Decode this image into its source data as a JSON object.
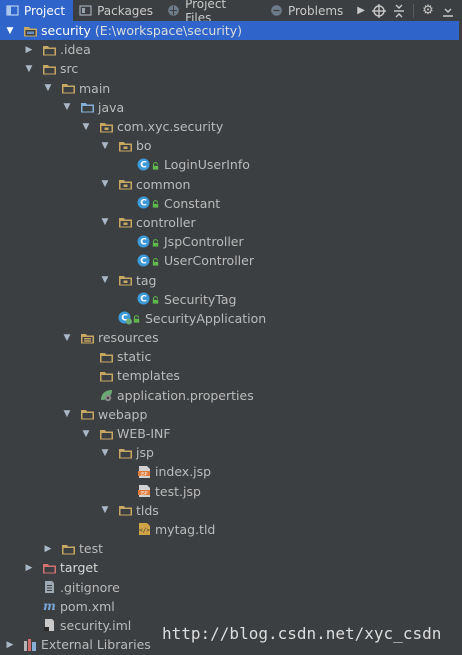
{
  "tabs": [
    {
      "label": "Project",
      "active": true,
      "icon": "project-icon"
    },
    {
      "label": "Packages",
      "active": false,
      "icon": "packages-icon"
    },
    {
      "label": "Project Files",
      "active": false,
      "icon": "project-files-icon"
    },
    {
      "label": "Problems",
      "active": false,
      "icon": "problems-icon"
    }
  ],
  "toolbar": [
    "more-tabs-icon",
    "sync-icon",
    "collapse-icon",
    "gear-icon",
    "hide-icon"
  ],
  "tree": [
    {
      "label": "security",
      "suffix": "(E:\\workspace\\security)",
      "depth": 0,
      "arrow": "open",
      "icon": "module-folder",
      "selected": true
    },
    {
      "label": ".idea",
      "depth": 1,
      "arrow": "closed",
      "icon": "folder"
    },
    {
      "label": "src",
      "depth": 1,
      "arrow": "open",
      "icon": "folder"
    },
    {
      "label": "main",
      "depth": 2,
      "arrow": "open",
      "icon": "folder"
    },
    {
      "label": "java",
      "depth": 3,
      "arrow": "open",
      "icon": "source-folder"
    },
    {
      "label": "com.xyc.security",
      "depth": 4,
      "arrow": "open",
      "icon": "package"
    },
    {
      "label": "bo",
      "depth": 5,
      "arrow": "open",
      "icon": "package"
    },
    {
      "label": "LoginUserInfo",
      "depth": 6,
      "arrow": "none",
      "icon": "class"
    },
    {
      "label": "common",
      "depth": 5,
      "arrow": "open",
      "icon": "package"
    },
    {
      "label": "Constant",
      "depth": 6,
      "arrow": "none",
      "icon": "class"
    },
    {
      "label": "controller",
      "depth": 5,
      "arrow": "open",
      "icon": "package"
    },
    {
      "label": "JspController",
      "depth": 6,
      "arrow": "none",
      "icon": "class"
    },
    {
      "label": "UserController",
      "depth": 6,
      "arrow": "none",
      "icon": "class"
    },
    {
      "label": "tag",
      "depth": 5,
      "arrow": "open",
      "icon": "package"
    },
    {
      "label": "SecurityTag",
      "depth": 6,
      "arrow": "none",
      "icon": "class"
    },
    {
      "label": "SecurityApplication",
      "depth": 5,
      "arrow": "none",
      "icon": "spring-class"
    },
    {
      "label": "resources",
      "depth": 3,
      "arrow": "open",
      "icon": "resources-folder"
    },
    {
      "label": "static",
      "depth": 4,
      "arrow": "none",
      "icon": "folder"
    },
    {
      "label": "templates",
      "depth": 4,
      "arrow": "none",
      "icon": "folder"
    },
    {
      "label": "application.properties",
      "depth": 4,
      "arrow": "none",
      "icon": "spring-properties"
    },
    {
      "label": "webapp",
      "depth": 3,
      "arrow": "open",
      "icon": "folder"
    },
    {
      "label": "WEB-INF",
      "depth": 4,
      "arrow": "open",
      "icon": "folder"
    },
    {
      "label": "jsp",
      "depth": 5,
      "arrow": "open",
      "icon": "folder"
    },
    {
      "label": "index.jsp",
      "depth": 6,
      "arrow": "none",
      "icon": "jsp-file"
    },
    {
      "label": "test.jsp",
      "depth": 6,
      "arrow": "none",
      "icon": "jsp-file"
    },
    {
      "label": "tlds",
      "depth": 5,
      "arrow": "open",
      "icon": "folder"
    },
    {
      "label": "mytag.tld",
      "depth": 6,
      "arrow": "none",
      "icon": "tld-file"
    },
    {
      "label": "test",
      "depth": 2,
      "arrow": "closed",
      "icon": "folder"
    },
    {
      "label": "target",
      "depth": 1,
      "arrow": "closed",
      "icon": "excluded-folder"
    },
    {
      "label": ".gitignore",
      "depth": 1,
      "arrow": "none",
      "icon": "text-file"
    },
    {
      "label": "pom.xml",
      "depth": 1,
      "arrow": "none",
      "icon": "maven-file"
    },
    {
      "label": "security.iml",
      "depth": 1,
      "arrow": "none",
      "icon": "iml-file"
    },
    {
      "label": "External Libraries",
      "depth": 0,
      "arrow": "closed",
      "icon": "libraries"
    }
  ],
  "watermark": "http://blog.csdn.net/xyc_csdn",
  "colors": {
    "background": "#3c3f41",
    "selection": "#2f65ca",
    "folder": "#c7a862",
    "class": "#3d9ad9",
    "lock": "#5fb84b",
    "spring": "#6aab73",
    "excluded": "#d25252"
  }
}
